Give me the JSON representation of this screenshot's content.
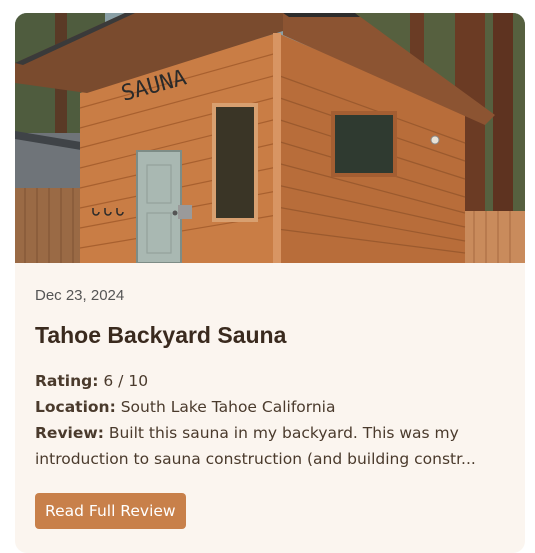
{
  "card": {
    "image_alt": "Backyard sauna cabin",
    "sign_text": "SAUNA",
    "date": "Dec 23, 2024",
    "title": "Tahoe Backyard Sauna",
    "rating_label": "Rating:",
    "rating_value": "6 / 10",
    "location_label": "Location:",
    "location_value": "South Lake Tahoe California",
    "review_label": "Review:",
    "review_line1": "Built this sauna in my backyard. This was my",
    "review_line2": "introduction to sauna construction (and building constr...",
    "button_label": "Read Full Review"
  },
  "colors": {
    "card_bg": "#fbf5ef",
    "button_bg": "#c8804a",
    "title": "#3a2a1e",
    "text": "#4a3a2c"
  }
}
